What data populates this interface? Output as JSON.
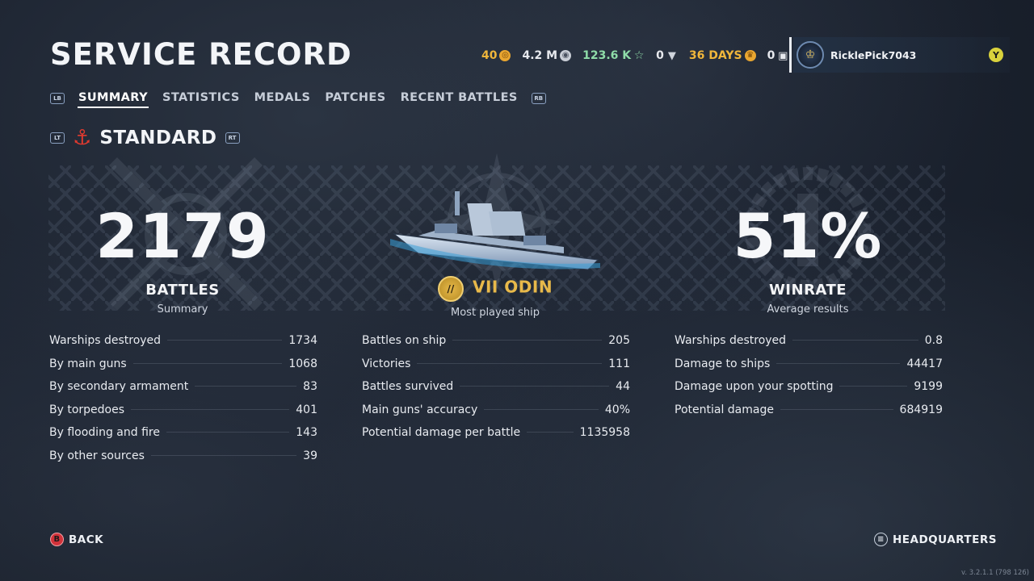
{
  "page": {
    "title": "SERVICE RECORD",
    "version": "v. 3.2.1.1 (798 126)"
  },
  "currencies": [
    {
      "value": "40",
      "icon": "doubloon-icon",
      "color": "#f0b63b"
    },
    {
      "value": "4.2 M",
      "icon": "credits-icon",
      "color": "#e7e9ee"
    },
    {
      "value": "123.6 K",
      "icon": "free-xp-icon",
      "color": "#8fdca8"
    },
    {
      "value": "0",
      "icon": "coal-icon",
      "color": "#e7e9ee"
    },
    {
      "value": "36 DAYS",
      "icon": "premium-account-icon",
      "color": "#f0b63b"
    },
    {
      "value": "0",
      "icon": "container-icon",
      "color": "#e7e9ee"
    }
  ],
  "profile": {
    "username": "RicklePick7043",
    "button": "Y"
  },
  "tabs": {
    "left_bumper": "LB",
    "right_bumper": "RB",
    "items": [
      "SUMMARY",
      "STATISTICS",
      "MEDALS",
      "PATCHES",
      "RECENT BATTLES"
    ],
    "active": "SUMMARY"
  },
  "mode": {
    "left_trigger": "LT",
    "right_trigger": "RT",
    "label": "STANDARD"
  },
  "hero": {
    "battles": {
      "value": "2179",
      "label": "BATTLES",
      "sub": "Summary"
    },
    "ship": {
      "tier": "VII",
      "name": "VII ODIN",
      "sub": "Most played ship"
    },
    "winrate": {
      "value": "51%",
      "label": "WINRATE",
      "sub": "Average results"
    }
  },
  "stats": {
    "left": [
      {
        "label": "Warships destroyed",
        "value": "1734"
      },
      {
        "label": "By main guns",
        "value": "1068"
      },
      {
        "label": "By secondary armament",
        "value": "83"
      },
      {
        "label": "By torpedoes",
        "value": "401"
      },
      {
        "label": "By flooding and fire",
        "value": "143"
      },
      {
        "label": "By other sources",
        "value": "39"
      }
    ],
    "middle": [
      {
        "label": "Battles on ship",
        "value": "205"
      },
      {
        "label": "Victories",
        "value": "111"
      },
      {
        "label": "Battles survived",
        "value": "44"
      },
      {
        "label": "Main guns' accuracy",
        "value": "40%"
      },
      {
        "label": "Potential damage per battle",
        "value": "1135958"
      }
    ],
    "right": [
      {
        "label": "Warships destroyed",
        "value": "0.8"
      },
      {
        "label": "Damage to ships",
        "value": "44417"
      },
      {
        "label": "Damage upon your spotting",
        "value": "9199"
      },
      {
        "label": "Potential damage",
        "value": "684919"
      }
    ]
  },
  "footer": {
    "back": {
      "button": "B",
      "label": "BACK"
    },
    "headquarters": {
      "label": "HEADQUARTERS"
    }
  },
  "colors": {
    "accent_gold": "#e8b94a",
    "anchor_red": "#e03a2f",
    "b_button_red": "#d1323a",
    "y_button_yellow": "#d9d23c"
  }
}
